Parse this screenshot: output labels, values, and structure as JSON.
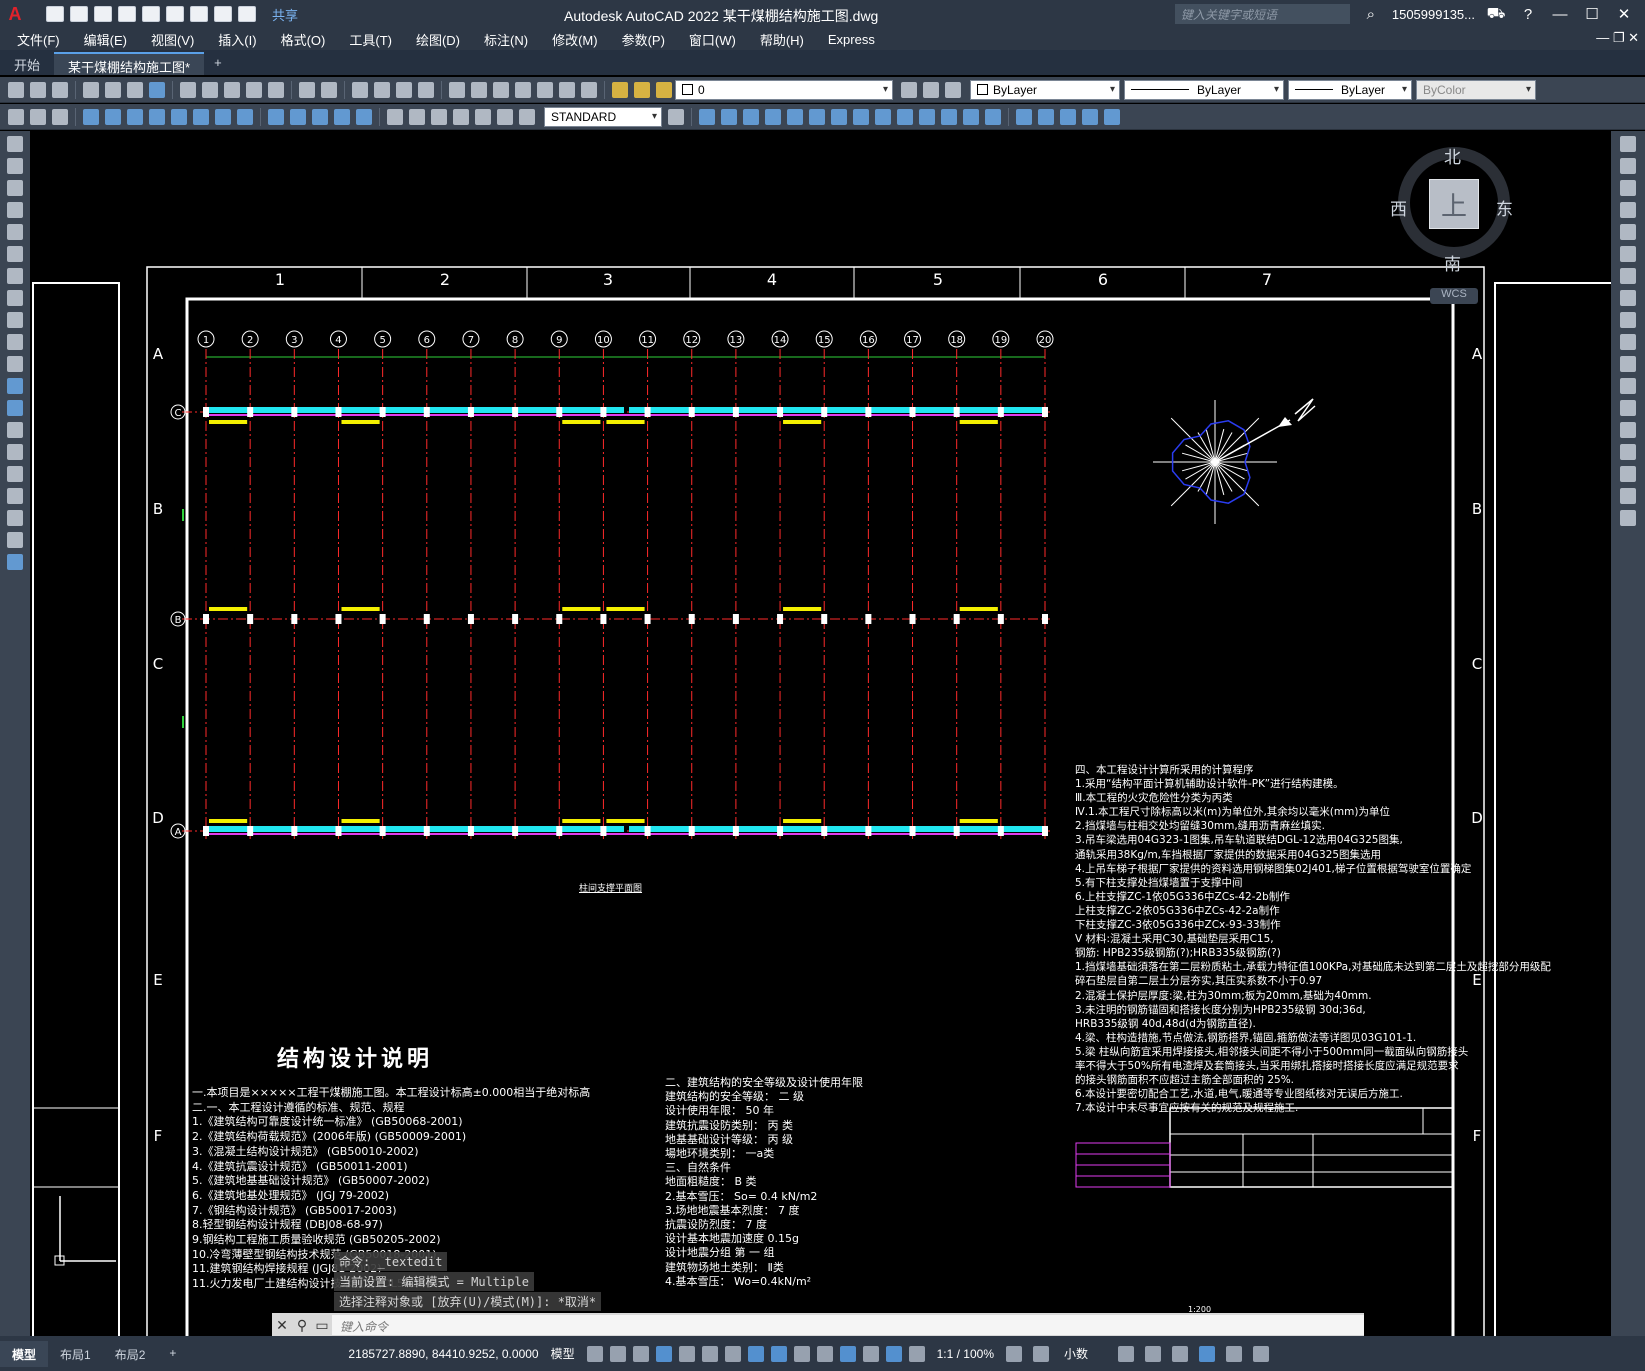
{
  "app": {
    "title": "Autodesk AutoCAD 2022    某干煤棚结构施工图.dwg",
    "logo": "A",
    "share_label": "共享",
    "search_placeholder": "键入关键字或短语",
    "user": "1505999135...",
    "accent": "#e0222b"
  },
  "menu": [
    "文件(F)",
    "编辑(E)",
    "视图(V)",
    "插入(I)",
    "格式(O)",
    "工具(T)",
    "绘图(D)",
    "标注(N)",
    "修改(M)",
    "参数(P)",
    "窗口(W)",
    "帮助(H)",
    "Express"
  ],
  "tabs": {
    "start": "开始",
    "drawing": "某干煤棚结构施工图*",
    "add": "+"
  },
  "toolbar": {
    "layer_value": "0",
    "color_value": "ByLayer",
    "linetype_value": "ByLayer",
    "lineweight_value": "ByLayer",
    "plotstyle_value": "ByColor",
    "textstyle_value": "STANDARD"
  },
  "viewcube": {
    "north": "北",
    "south": "南",
    "east": "东",
    "west": "西",
    "top": "上",
    "wcs": "WCS"
  },
  "drawing": {
    "frame_cols": [
      "1",
      "2",
      "3",
      "4",
      "5",
      "6",
      "7"
    ],
    "frame_rows": [
      "A",
      "B",
      "C",
      "D",
      "E",
      "F"
    ],
    "axis_numbers": [
      "1",
      "2",
      "3",
      "4",
      "5",
      "6",
      "7",
      "8",
      "9",
      "10",
      "11",
      "12",
      "13",
      "14",
      "15",
      "16",
      "17",
      "18",
      "19",
      "20"
    ],
    "row_axes": [
      "C",
      "B",
      "A"
    ],
    "plan_caption": "柱间支撑平面图",
    "title": "结构设计说明",
    "notes_left": [
      "一.本项目是×××××工程干煤棚施工图。本工程设计标高±0.000相当于绝对标高",
      "二.一、本工程设计遵循的标准、规范、规程",
      "1.《建筑结构可靠度设计统一标准》         (GB50068-2001)",
      "2.《建筑结构荷载规范》(2006年版)        (GB50009-2001)",
      "3.《混凝土结构设计规范》               (GB50010-2002)",
      "4.《建筑抗震设计规范》                 (GB50011-2001)",
      "5.《建筑地基基础设计规范》              (GB50007-2002)",
      "6.《建筑地基处理规范》                  (JGJ 79-2002)",
      "7.《钢结构设计规范》                    (GB50017-2003)",
      "8.轻型钢结构设计规程                  (DBJ08-68-97)",
      "9.钢结构工程施工质量验收规范            (GB50205-2002)",
      "10.冷弯薄壁型钢结构技术规范             (GB50018-2001)",
      "11.建筑钢结构焊接规程                  (JGJ81-2002)",
      "11.火力发电厂土建结构设计技术规定          (DL5022-93)"
    ],
    "notes_mid": [
      "二、建筑结构的安全等级及设计使用年限",
      "建筑结构的安全等级：     二 级",
      "设计使用年限：           50 年",
      "建筑抗震设防类别：         丙 类",
      "地基基础设计等级：         丙 级",
      "場地环境类别：            一a类",
      "三、自然条件",
      "地面粗糙度：          B 类",
      "2.基本雪压：        So= 0.4 kN/m2",
      "3.场地地震基本烈度：       7 度",
      "抗震设防烈度：          7 度",
      "设计基本地震加速度      0.15g",
      "设计地震分组           第 一 组",
      "建筑物场地土类别：        Ⅱ类",
      "4.基本雪压：           Wo=0.4kN/m²"
    ],
    "notes_right": [
      "四、本工程设计计算所采用的计算程序",
      "1.采用“结构平面计算机辅助设计软件-PK”进行结构建模。",
      "Ⅲ.本工程的火灾危险性分类为丙类",
      "Ⅳ.1.本工程尺寸除标高以米(m)为单位外,其余均以毫米(mm)为单位",
      "2.挡煤墙与柱相交处均留缝30mm,缝用沥青麻丝填实.",
      "3.吊车梁选用04G323-1图集,吊车轨道联结DGL-12选用04G325图集,",
      "   通轨采用38Kg/m,车挡根据厂家提供的数据采用04G325图集选用",
      "4.上吊车梯子根据厂家提供的资料选用钢梯图集02J401,梯子位置根据驾驶室位置确定",
      "5.有下柱支撑处挡煤墙置于支撑中间",
      "6.上柱支撑ZC-1依05G336中ZCs-42-2b制作",
      "   上柱支撑ZC-2依05G336中ZCs-42-2a制作",
      "   下柱支撑ZC-3依05G336中ZCx-93-33制作",
      "Ⅴ 材料:混凝土采用C30,基础垫层采用C15,",
      "   钢筋: HPB235级钢筋(?);HRB335级钢筋(?)",
      "1.挡煤墙基础須落在第二层粉质粘土,承载力特征值100KPa,对基础底未达到第二层土及超挖部分用级配",
      "   碎石垫层自第二层土分层夯实,其压实系数不小于0.97",
      "2.混凝土保护层厚度:梁,柱为30mm;板为20mm,基础为40mm.",
      "3.未注明的钢筋锚固和搭接长度分别为HPB235级钢 30d;36d,",
      "                    HRB335级钢 40d,48d(d为钢筋直径).",
      "4.梁、柱构造措施,节点做法,钢筋搭界,锚固,箍筋做法等详图见03G101-1.",
      "5.梁 柱纵向筋宜采用焊接接头,相邻接头间距不得小于500mm同一截面纵向钢筋接头",
      "   率不得大于50%所有电渣焊及套筒接头,当采用绑扎搭接时搭接长度应满足规范要求",
      "   的接头钢筋面积不应超过主筋全部面积的 25%.",
      "6.本设计要密切配合工艺,水道,电气,暖通等专业图纸核对无误后方施工.",
      "7.本设计中未尽事宜应按有关的规范及规程施工."
    ],
    "title_block_scale": "1:200"
  },
  "command": {
    "history": [
      "命令: _textedit",
      "当前设置: 编辑模式 = Multiple",
      "选择注释对象或 [放弃(U)/模式(M)]: *取消*"
    ],
    "placeholder": "键入命令"
  },
  "status": {
    "tabs": [
      "模型",
      "布局1",
      "布局2",
      "+"
    ],
    "coords": "2185727.8890, 84410.9252, 0.0000",
    "space": "模型",
    "scale": "1:1 / 100%",
    "units": "小数"
  }
}
